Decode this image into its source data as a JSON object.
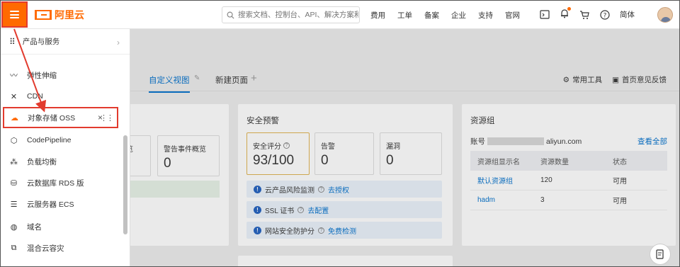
{
  "header": {
    "logo_text": "阿里云",
    "search_placeholder": "搜索文档、控制台、API、解决方案和资源",
    "nav": [
      "费用",
      "工单",
      "备案",
      "企业",
      "支持",
      "官网"
    ],
    "lang": "简体"
  },
  "tabs": {
    "custom_view": "自定义视图",
    "new_page": "新建页面",
    "common_tools": "常用工具",
    "feedback": "首页意见反馈"
  },
  "left_card": {
    "label_partial": "览",
    "event_label": "警告事件概览",
    "event_value": "0"
  },
  "security": {
    "title": "安全预警",
    "score_label": "安全评分",
    "score_value": "93/100",
    "alert_label": "告警",
    "alert_value": "0",
    "vuln_label": "漏洞",
    "vuln_value": "0",
    "items": [
      {
        "text": "云产品风险监测",
        "link": "去授权"
      },
      {
        "text": "SSL 证书",
        "link": "去配置"
      },
      {
        "text": "网站安全防护分",
        "link": "免费检测"
      }
    ]
  },
  "resource_group": {
    "title": "资源组",
    "account_label": "账号",
    "account_suffix": "aliyun.com",
    "view_all": "查看全部",
    "columns": [
      "资源组显示名",
      "资源数量",
      "状态"
    ],
    "rows": [
      {
        "name": "默认资源组",
        "count": "120",
        "status": "可用"
      },
      {
        "name": "hadm",
        "count": "3",
        "status": "可用"
      }
    ]
  },
  "sidemenu": {
    "header": "产品与服务",
    "items": [
      {
        "label": "弹性伸缩",
        "icon": "autoscale-icon"
      },
      {
        "label": "CDN",
        "icon": "cdn-icon"
      },
      {
        "label": "对象存储 OSS",
        "icon": "oss-cloud-icon"
      },
      {
        "label": "CodePipeline",
        "icon": "codepipeline-icon"
      },
      {
        "label": "负载均衡",
        "icon": "slb-icon"
      },
      {
        "label": "云数据库 RDS 版",
        "icon": "rds-icon"
      },
      {
        "label": "云服务器 ECS",
        "icon": "ecs-icon"
      },
      {
        "label": "域名",
        "icon": "domain-icon"
      },
      {
        "label": "混合云容灾",
        "icon": "hybrid-dr-icon"
      }
    ]
  },
  "colors": {
    "brand": "#ff6a00",
    "highlight_border": "#e23b2e",
    "link": "#0070cc"
  }
}
